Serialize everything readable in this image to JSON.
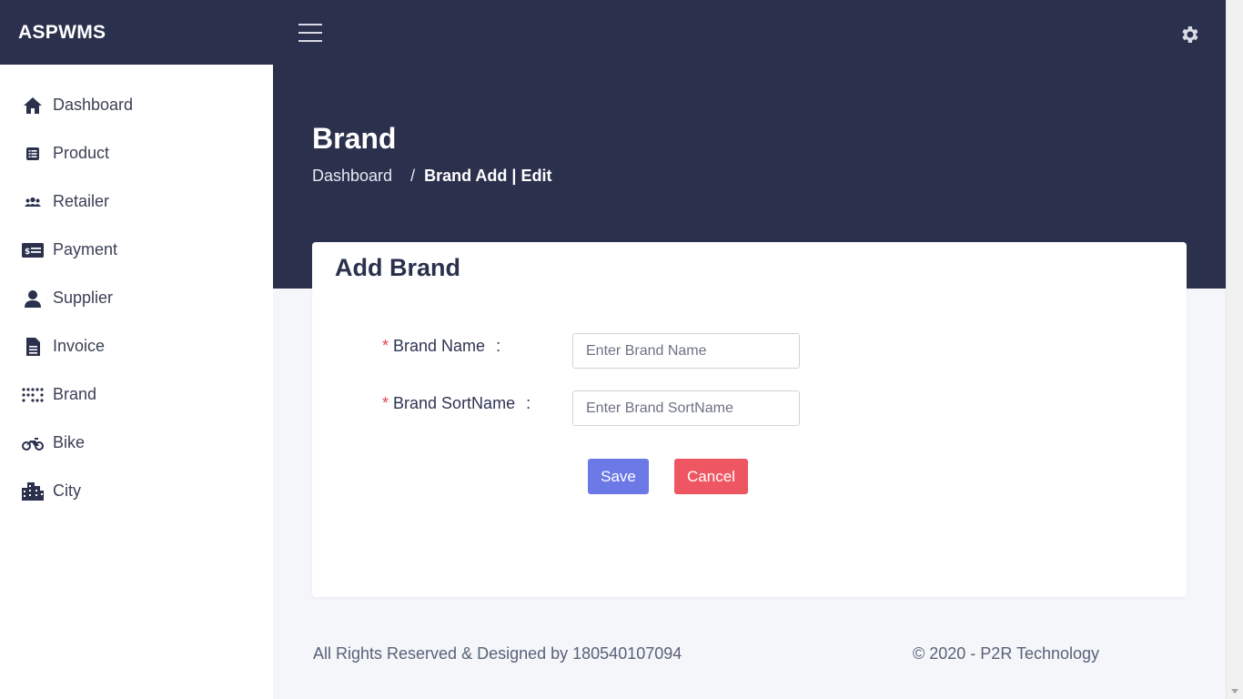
{
  "app": {
    "title": "ASPWMS"
  },
  "sidebar": {
    "items": [
      {
        "label": "Dashboard",
        "icon": "home-icon"
      },
      {
        "label": "Product",
        "icon": "list-icon"
      },
      {
        "label": "Retailer",
        "icon": "users-icon"
      },
      {
        "label": "Payment",
        "icon": "money-check-icon"
      },
      {
        "label": "Supplier",
        "icon": "user-icon"
      },
      {
        "label": "Invoice",
        "icon": "file-icon"
      },
      {
        "label": "Brand",
        "icon": "dots-grid-icon"
      },
      {
        "label": "Bike",
        "icon": "motorcycle-icon"
      },
      {
        "label": "City",
        "icon": "city-icon"
      }
    ]
  },
  "header": {
    "menu_icon": "hamburger-icon",
    "settings_icon": "gear-icon",
    "page_title": "Brand",
    "breadcrumb": {
      "home": "Dashboard",
      "separator": "/",
      "current": "Brand Add | Edit"
    }
  },
  "form": {
    "title": "Add Brand",
    "required_mark": "*",
    "colon": ":",
    "brand_name": {
      "label": "Brand Name",
      "placeholder": "Enter Brand Name",
      "value": ""
    },
    "brand_sortname": {
      "label": "Brand SortName",
      "placeholder": "Enter Brand SortName",
      "value": ""
    },
    "save_label": "Save",
    "cancel_label": "Cancel"
  },
  "footer": {
    "left": "All Rights Reserved & Designed by 180540107094",
    "right": "© 2020 - P2R Technology"
  },
  "colors": {
    "header_bg": "#2b304d",
    "save": "#6b78e5",
    "cancel": "#ee5661",
    "required": "#e0464f"
  }
}
